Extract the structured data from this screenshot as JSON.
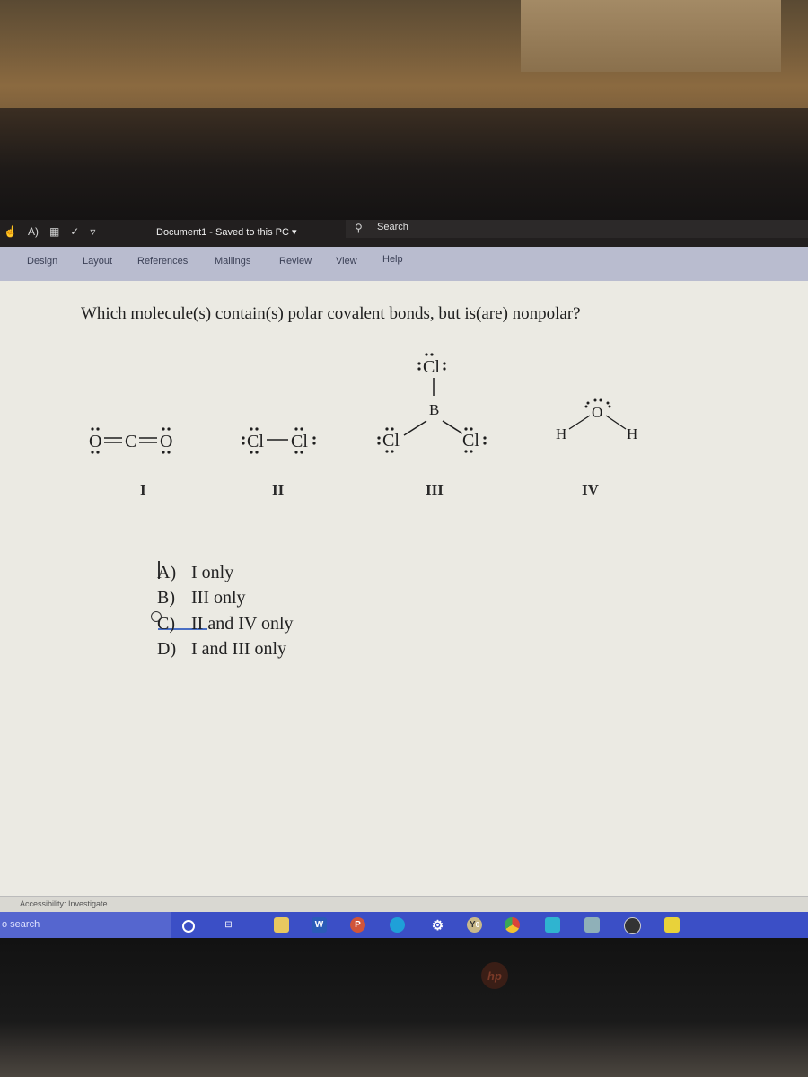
{
  "window": {
    "document_title": "Document1  -  Saved to this PC  ▾",
    "search_label": "Search",
    "quick_access_icons": [
      "touch-mode-icon",
      "read-aloud-icon",
      "layout-icon",
      "spelling-icon",
      "customize-icon"
    ]
  },
  "ribbon": {
    "tabs": [
      {
        "label": "Design"
      },
      {
        "label": "Layout"
      },
      {
        "label": "References"
      },
      {
        "label": "Mailings"
      },
      {
        "label": "Review"
      },
      {
        "label": "View"
      },
      {
        "label": "Help"
      }
    ]
  },
  "document": {
    "question": "Which molecule(s) contain(s) polar covalent bonds, but is(are) nonpolar?",
    "molecules": [
      {
        "label": "I",
        "structure": "Ö=C=Ö",
        "name": "CO2"
      },
      {
        "label": "II",
        "structure": ":C̈l—C̈l:",
        "name": "Cl2"
      },
      {
        "label": "III",
        "structure": "BCl3",
        "name": "BCl3",
        "atoms": {
          "top": ":C̈l:",
          "center": "B",
          "left": ":C̈l",
          "right": "C̈l:"
        }
      },
      {
        "label": "IV",
        "structure": "H2O",
        "name": "H2O",
        "atoms": {
          "center": "Ö",
          "left": "H",
          "right": "H"
        }
      }
    ],
    "choices": [
      {
        "letter": "A)",
        "text": "I only"
      },
      {
        "letter": "B)",
        "text": "III only"
      },
      {
        "letter": "C)",
        "text": "II and IV only"
      },
      {
        "letter": "D)",
        "text": "I and III only"
      }
    ]
  },
  "statusbar": {
    "accessibility": "Accessibility: Investigate"
  },
  "taskbar": {
    "search_placeholder": "o search",
    "apps": [
      "cortana",
      "task-view",
      "file-explorer",
      "word",
      "powerpoint",
      "edge",
      "settings",
      "yammer",
      "chrome",
      "calendar",
      "calculator",
      "obs",
      "sticky-notes"
    ],
    "yammer_badge": "0"
  },
  "laptop": {
    "brand": "hp"
  }
}
